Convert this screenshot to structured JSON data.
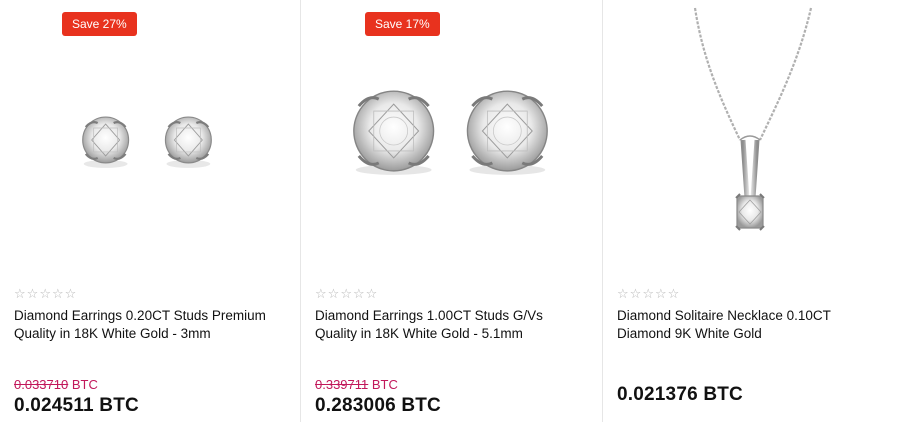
{
  "products": [
    {
      "badge": "Save 27%",
      "rating_stars": "☆☆☆☆☆",
      "title": "Diamond Earrings 0.20CT Studs Premium Quality in 18K White Gold - 3mm",
      "old_price_amount": "0.033710",
      "old_price_currency": " BTC",
      "price": "0.024511 BTC",
      "image_icon": "diamond-stud-earrings-small"
    },
    {
      "badge": "Save 17%",
      "rating_stars": "☆☆☆☆☆",
      "title": "Diamond Earrings 1.00CT Studs G/Vs Quality in 18K White Gold - 5.1mm",
      "old_price_amount": "0.339711",
      "old_price_currency": " BTC",
      "price": "0.283006 BTC",
      "image_icon": "diamond-stud-earrings-large"
    },
    {
      "rating_stars": "☆☆☆☆☆",
      "title": "Diamond Solitaire Necklace 0.10CT Diamond 9K White Gold",
      "price": "0.021376 BTC",
      "image_icon": "diamond-solitaire-necklace"
    }
  ],
  "colors": {
    "badge_bg": "#e8321e",
    "old_price": "#c2185b",
    "star_outline": "#b8b8b8"
  }
}
